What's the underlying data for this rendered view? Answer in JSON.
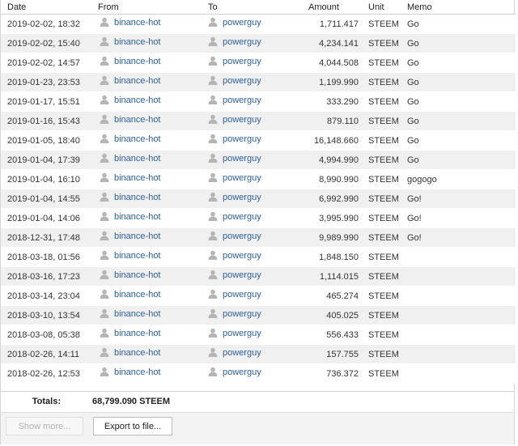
{
  "columns": {
    "date": "Date",
    "from": "From",
    "to": "To",
    "amount": "Amount",
    "unit": "Unit",
    "memo": "Memo"
  },
  "rows": [
    {
      "date": "2019-02-02, 18:32",
      "from": "binance-hot",
      "to": "powerguy",
      "amount": "1,711.417",
      "unit": "STEEM",
      "memo": "Go"
    },
    {
      "date": "2019-02-02, 15:40",
      "from": "binance-hot",
      "to": "powerguy",
      "amount": "4,234.141",
      "unit": "STEEM",
      "memo": "Go"
    },
    {
      "date": "2019-02-02, 14:57",
      "from": "binance-hot",
      "to": "powerguy",
      "amount": "4,044.508",
      "unit": "STEEM",
      "memo": "Go"
    },
    {
      "date": "2019-01-23, 23:53",
      "from": "binance-hot",
      "to": "powerguy",
      "amount": "1,199.990",
      "unit": "STEEM",
      "memo": "Go"
    },
    {
      "date": "2019-01-17, 15:51",
      "from": "binance-hot",
      "to": "powerguy",
      "amount": "333.290",
      "unit": "STEEM",
      "memo": "Go"
    },
    {
      "date": "2019-01-16, 15:43",
      "from": "binance-hot",
      "to": "powerguy",
      "amount": "879.110",
      "unit": "STEEM",
      "memo": "Go"
    },
    {
      "date": "2019-01-05, 18:40",
      "from": "binance-hot",
      "to": "powerguy",
      "amount": "16,148.660",
      "unit": "STEEM",
      "memo": "Go"
    },
    {
      "date": "2019-01-04, 17:39",
      "from": "binance-hot",
      "to": "powerguy",
      "amount": "4,994.990",
      "unit": "STEEM",
      "memo": "Go"
    },
    {
      "date": "2019-01-04, 16:10",
      "from": "binance-hot",
      "to": "powerguy",
      "amount": "8,990.990",
      "unit": "STEEM",
      "memo": "gogogo"
    },
    {
      "date": "2019-01-04, 14:55",
      "from": "binance-hot",
      "to": "powerguy",
      "amount": "6,992.990",
      "unit": "STEEM",
      "memo": "Go!"
    },
    {
      "date": "2019-01-04, 14:06",
      "from": "binance-hot",
      "to": "powerguy",
      "amount": "3,995.990",
      "unit": "STEEM",
      "memo": "Go!"
    },
    {
      "date": "2018-12-31, 17:48",
      "from": "binance-hot",
      "to": "powerguy",
      "amount": "9,989.990",
      "unit": "STEEM",
      "memo": "Go!"
    },
    {
      "date": "2018-03-18, 01:56",
      "from": "binance-hot",
      "to": "powerguy",
      "amount": "1,848.150",
      "unit": "STEEM",
      "memo": ""
    },
    {
      "date": "2018-03-16, 17:23",
      "from": "binance-hot",
      "to": "powerguy",
      "amount": "1,114.015",
      "unit": "STEEM",
      "memo": ""
    },
    {
      "date": "2018-03-14, 23:04",
      "from": "binance-hot",
      "to": "powerguy",
      "amount": "465.274",
      "unit": "STEEM",
      "memo": ""
    },
    {
      "date": "2018-03-10, 13:54",
      "from": "binance-hot",
      "to": "powerguy",
      "amount": "405.025",
      "unit": "STEEM",
      "memo": ""
    },
    {
      "date": "2018-03-08, 05:38",
      "from": "binance-hot",
      "to": "powerguy",
      "amount": "556.433",
      "unit": "STEEM",
      "memo": ""
    },
    {
      "date": "2018-02-26, 14:11",
      "from": "binance-hot",
      "to": "powerguy",
      "amount": "157.755",
      "unit": "STEEM",
      "memo": ""
    },
    {
      "date": "2018-02-26, 12:53",
      "from": "binance-hot",
      "to": "powerguy",
      "amount": "736.372",
      "unit": "STEEM",
      "memo": ""
    }
  ],
  "account_icon": "user-icon",
  "totals": {
    "label": "Totals:",
    "value": "68,799.090 STEEM"
  },
  "footer": {
    "show_more_label": "Show more...",
    "export_label": "Export to file..."
  },
  "colors": {
    "link": "#2d5f9a",
    "row_alt": "#f0f0f0",
    "icon": "#b5b5b5"
  }
}
